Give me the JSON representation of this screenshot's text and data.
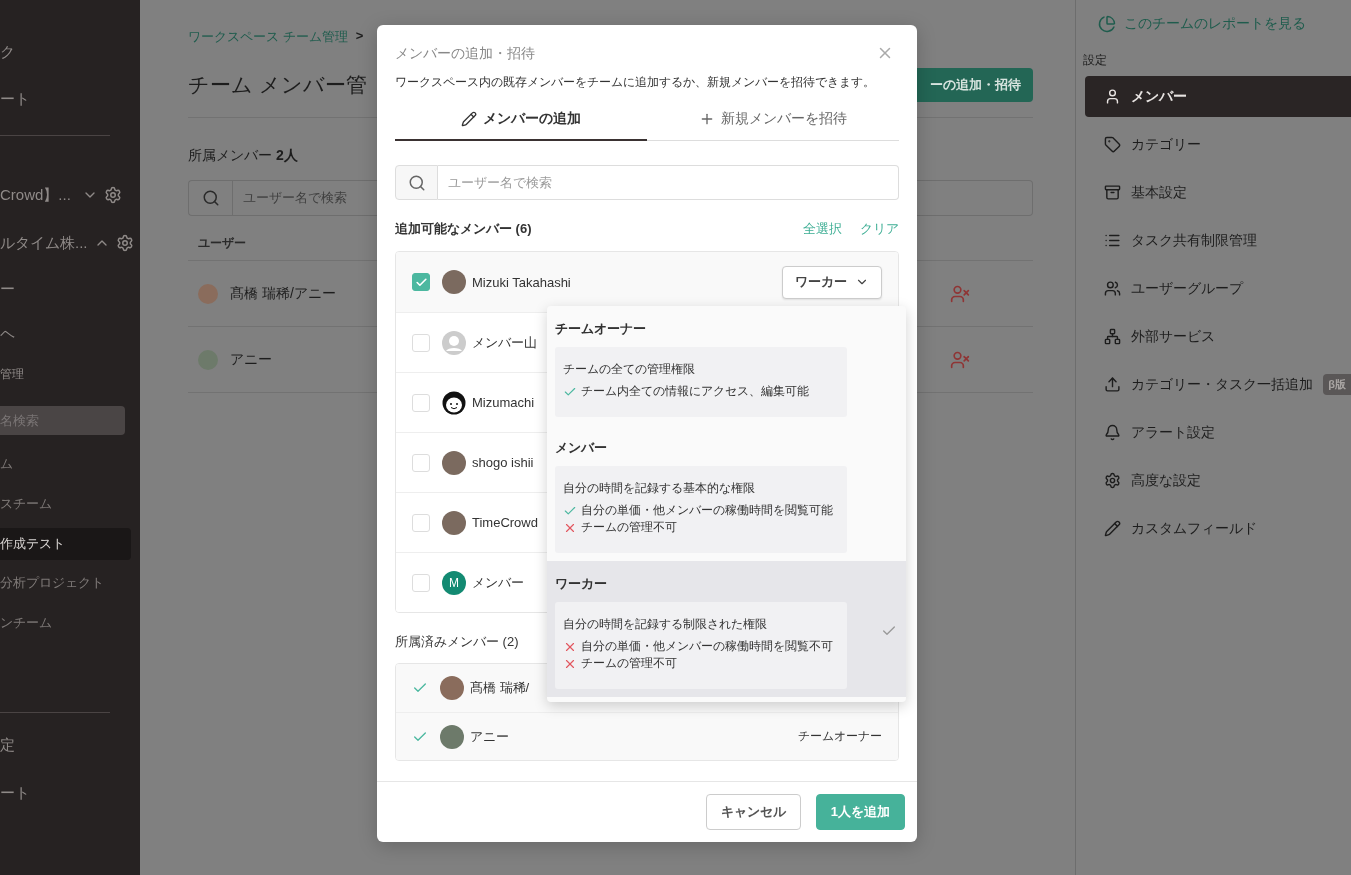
{
  "sidebar": {
    "top": [
      {
        "label": "ク"
      },
      {
        "label": "ート"
      }
    ],
    "teams": [
      {
        "label": "Crowd】...",
        "expanded": false
      },
      {
        "label": "ルタイム株...",
        "expanded": true
      }
    ],
    "team_links": [
      {
        "label": "ー",
        "kind": "link"
      },
      {
        "label": "ヘ",
        "kind": "link"
      },
      {
        "label": "管理",
        "kind": "caption"
      }
    ],
    "project_search": {
      "placeholder": "名検索"
    },
    "projects": [
      {
        "label": "ム",
        "selected": false
      },
      {
        "label": "スチーム",
        "selected": false
      },
      {
        "label": "作成テスト",
        "selected": true
      },
      {
        "label": "分析プロジェクト",
        "selected": false
      },
      {
        "label": "ンチーム",
        "selected": false
      }
    ],
    "bottom": [
      {
        "label": "定"
      },
      {
        "label": "ート"
      }
    ]
  },
  "main": {
    "breadcrumb": {
      "link": "ワークスペース チーム管理",
      "separator": ">"
    },
    "title": "チーム メンバー管",
    "add_button": "ーの追加・招待",
    "count_label": "所属メンバー",
    "count": "2人",
    "search": {
      "placeholder": "ユーザー名で検索"
    },
    "table": {
      "columns": [
        "ユーザー"
      ],
      "rows": [
        {
          "name": "髙橋 瑞稀/アニー"
        },
        {
          "name": "アニー"
        }
      ]
    }
  },
  "modal": {
    "title": "メンバーの追加・招待",
    "description": "ワークスペース内の既存メンバーをチームに追加するか、新規メンバーを招待できます。",
    "tabs": [
      {
        "label": "メンバーの追加",
        "kind": "edit",
        "selected": true
      },
      {
        "label": "新規メンバーを招待",
        "kind": "add",
        "selected": false
      }
    ],
    "search": {
      "placeholder": "ユーザー名で検索"
    },
    "available": {
      "heading": "追加可能なメンバー (6)",
      "select_all": "全選択",
      "clear": "クリア",
      "members": [
        {
          "name": "Mizuki Takahashi",
          "checked": true,
          "kind": "photo",
          "role": "ワーカー"
        },
        {
          "name": "メンバー山",
          "checked": false,
          "kind": "default"
        },
        {
          "name": "Mizumachi",
          "checked": false,
          "kind": "face"
        },
        {
          "name": "shogo ishii",
          "checked": false,
          "kind": "photo"
        },
        {
          "name": "TimeCrowd",
          "checked": false,
          "kind": "photo"
        },
        {
          "name": "メンバー",
          "checked": false,
          "kind": "letter",
          "initial": "M"
        }
      ]
    },
    "role_menu": {
      "options": [
        {
          "title": "チームオーナー",
          "summary": "チームの全ての管理権限",
          "selected": false,
          "points": [
            {
              "text": "チーム内全ての情報にアクセス、編集可能",
              "allowed": true
            }
          ]
        },
        {
          "title": "メンバー",
          "summary": "自分の時間を記録する基本的な権限",
          "selected": false,
          "points": [
            {
              "text": "自分の単価・他メンバーの稼働時間を閲覧可能",
              "allowed": true
            },
            {
              "text": "チームの管理不可",
              "allowed": false
            }
          ]
        },
        {
          "title": "ワーカー",
          "summary": "自分の時間を記録する制限された権限",
          "selected": true,
          "points": [
            {
              "text": "自分の単価・他メンバーの稼働時間を閲覧不可",
              "allowed": false
            },
            {
              "text": "チームの管理不可",
              "allowed": false
            }
          ]
        }
      ]
    },
    "joined": {
      "heading": "所属済みメンバー (2)",
      "members": [
        {
          "name": "髙橋 瑞稀/"
        },
        {
          "name": "アニー",
          "role": "チームオーナー"
        }
      ]
    },
    "buttons": {
      "cancel": "キャンセル",
      "submit": "1人を追加"
    }
  },
  "settings": {
    "report_link": "このチームのレポートを見る",
    "label": "設定",
    "items": [
      {
        "label": "メンバー",
        "kind": "user",
        "selected": true
      },
      {
        "label": "カテゴリー",
        "kind": "tag",
        "selected": false
      },
      {
        "label": "基本設定",
        "kind": "box",
        "selected": false
      },
      {
        "label": "タスク共有制限管理",
        "kind": "list",
        "selected": false
      },
      {
        "label": "ユーザーグループ",
        "kind": "users",
        "selected": false
      },
      {
        "label": "外部サービス",
        "kind": "tree",
        "selected": false
      },
      {
        "label": "カテゴリー・タスク一括追加",
        "kind": "upload",
        "selected": false,
        "badge": "β版"
      },
      {
        "label": "アラート設定",
        "kind": "bell",
        "selected": false
      },
      {
        "label": "高度な設定",
        "kind": "gear",
        "selected": false
      },
      {
        "label": "カスタムフィールド",
        "kind": "pencil",
        "selected": false
      }
    ]
  }
}
